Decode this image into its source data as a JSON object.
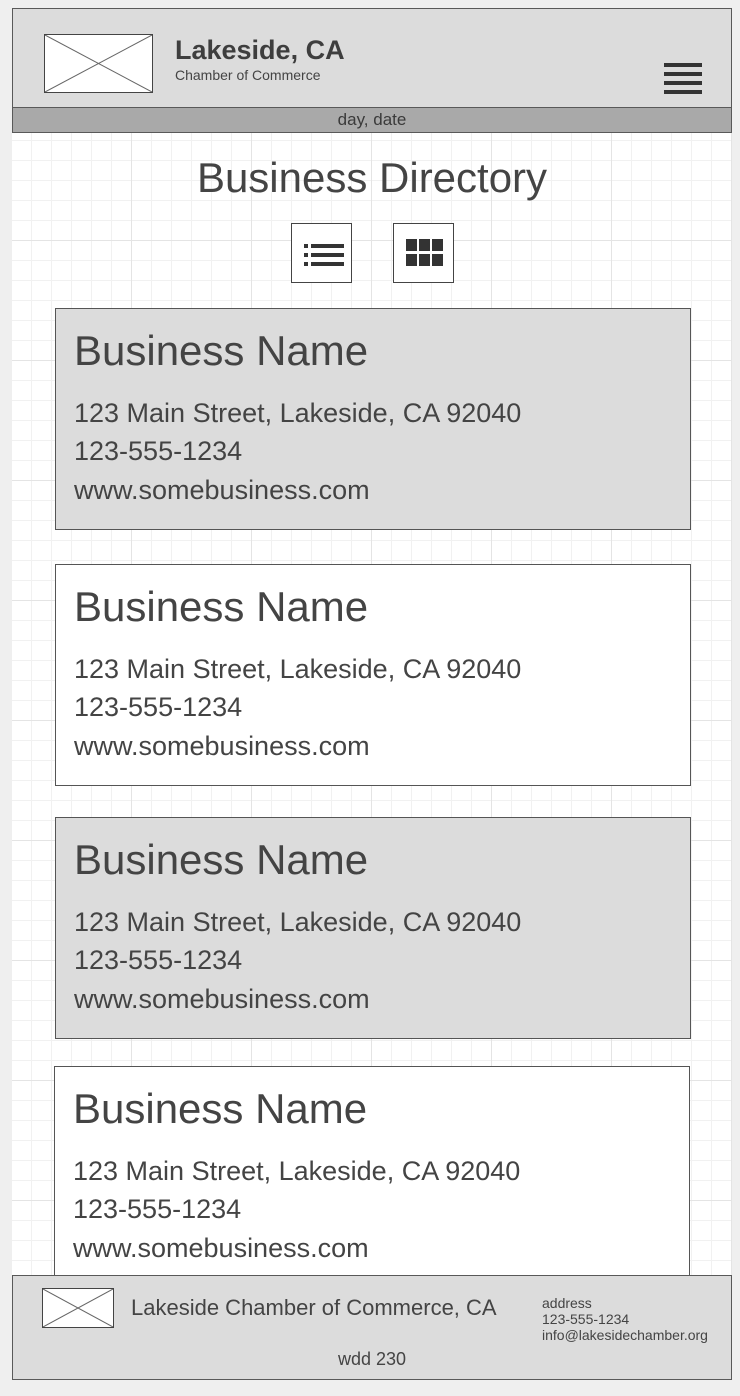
{
  "header": {
    "title": "Lakeside, CA",
    "subtitle": "Chamber of Commerce",
    "logo_icon": "image-placeholder-icon",
    "menu_icon": "hamburger-menu-icon"
  },
  "date_bar": {
    "text": "day, date"
  },
  "main": {
    "title": "Business Directory",
    "view_toggle": {
      "list_icon": "list-view-icon",
      "grid_icon": "grid-view-icon"
    },
    "businesses": [
      {
        "name": "Business Name",
        "address": "123 Main Street, Lakeside, CA 92040",
        "phone": "123-555-1234",
        "website": "www.somebusiness.com"
      },
      {
        "name": "Business Name",
        "address": "123 Main Street, Lakeside, CA 92040",
        "phone": "123-555-1234",
        "website": "www.somebusiness.com"
      },
      {
        "name": "Business Name",
        "address": "123 Main Street, Lakeside, CA 92040",
        "phone": "123-555-1234",
        "website": "www.somebusiness.com"
      },
      {
        "name": "Business Name",
        "address": "123 Main Street, Lakeside, CA 92040",
        "phone": "123-555-1234",
        "website": "www.somebusiness.com"
      }
    ]
  },
  "footer": {
    "logo_icon": "image-placeholder-icon",
    "org_name": "Lakeside Chamber of Commerce, CA",
    "contact": {
      "address": "address",
      "phone": "123-555-1234",
      "email": "info@lakesidechamber.org"
    },
    "credit": "wdd 230"
  },
  "colors": {
    "header_bg": "#dcdcdc",
    "date_bar_bg": "#a9a9a9",
    "card_shaded": "#dcdcdc",
    "text": "#444444"
  }
}
